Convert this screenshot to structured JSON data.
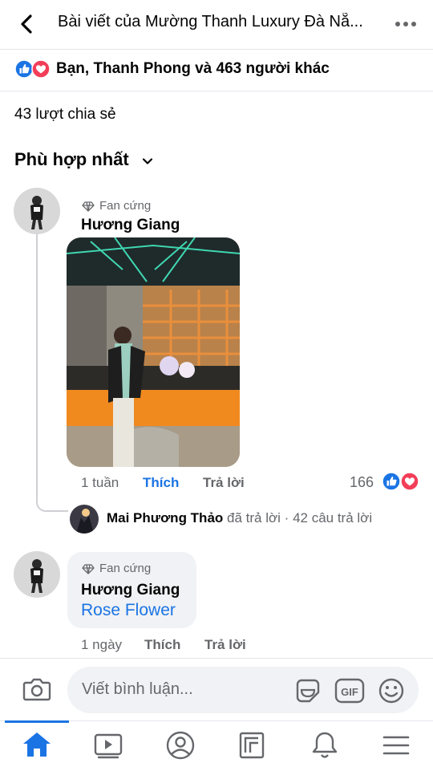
{
  "header": {
    "title": "Bài viết của Mường Thanh Luxury Đà Nẵ...",
    "back_icon": "back-arrow-icon",
    "more_icon": "more-horizontal-icon"
  },
  "reactions": {
    "summary": "Bạn, Thanh Phong và 463 người khác",
    "icons": [
      "like-icon",
      "love-icon"
    ]
  },
  "shares": "43 lượt chia sẻ",
  "sort": {
    "label": "Phù hợp nhất"
  },
  "comments": [
    {
      "badge": "Fan cứng",
      "author": "Hương Giang",
      "time": "1 tuần",
      "like_label": "Thích",
      "reply_label": "Trả lời",
      "reaction_count": "166",
      "reply_summary": {
        "name": "Mai Phương Thảo",
        "action": "đã trả lời",
        "separator": "·",
        "count": "42 câu trả lời"
      }
    },
    {
      "badge": "Fan cứng",
      "author": "Hương Giang",
      "text": "Rose Flower",
      "time": "1 ngày",
      "like_label": "Thích",
      "reply_label": "Trả lời"
    }
  ],
  "composer": {
    "placeholder": "Viết bình luận..."
  },
  "tabs": [
    "home-icon",
    "video-icon",
    "profile-icon",
    "pages-icon",
    "notifications-icon",
    "menu-icon"
  ],
  "colors": {
    "accent": "#1b74e4",
    "love": "#f33e58",
    "secondary_text": "#65676b",
    "bubble_bg": "#f0f2f5"
  }
}
